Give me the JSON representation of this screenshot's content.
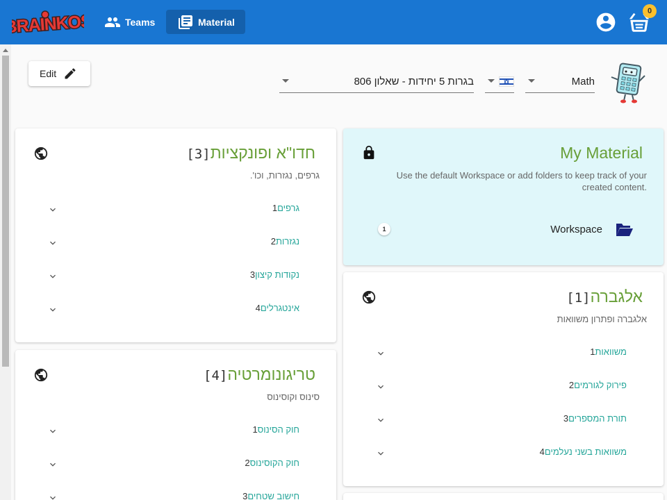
{
  "header": {
    "logo_text": "BRAINKOS",
    "nav": [
      {
        "label": "Teams",
        "icon": "people-icon"
      },
      {
        "label": "Material",
        "icon": "library-books-icon",
        "active": true
      }
    ],
    "cart_count": "0"
  },
  "toolbar": {
    "edit_label": "Edit",
    "curriculum": "בגרות 5 יחידות - שאלון 806",
    "language": "Hebrew",
    "subject": "Math"
  },
  "my_material": {
    "title": "My Material",
    "description": "Use the default Workspace or add folders to keep track of your created content.",
    "workspace_label": "Workspace",
    "workspace_count": "1"
  },
  "cards": {
    "algebra": {
      "num": "[1]",
      "title": "אלגברה",
      "subtitle": "אלגברה ופתרון משוואות",
      "items": [
        {
          "idx": "1",
          "label": "משוואות"
        },
        {
          "idx": "2",
          "label": "פירוק לגורמים"
        },
        {
          "idx": "3",
          "label": "תורת המספרים"
        },
        {
          "idx": "4",
          "label": "משוואות בשני נעלמים"
        }
      ]
    },
    "calculus": {
      "num": "[3]",
      "title": "חדו\"א ופונקציות",
      "subtitle": "גרפים, נגזרות, וכו'.",
      "items": [
        {
          "idx": "1",
          "label": "גרפים"
        },
        {
          "idx": "2",
          "label": "נגזרות"
        },
        {
          "idx": "3",
          "label": "נקודות קיצון"
        },
        {
          "idx": "4",
          "label": "אינטגרלים"
        }
      ]
    },
    "trig": {
      "num": "[4]",
      "title": "טריגונומרטיה",
      "subtitle": "סינוס וקוסינוס",
      "items": [
        {
          "idx": "1",
          "label": "חוק הסינוס"
        },
        {
          "idx": "2",
          "label": "חוק הקוסינוס"
        },
        {
          "idx": "3",
          "label": "חישוב שטחים"
        }
      ]
    }
  },
  "colors": {
    "header_bg": "#1976d2",
    "title_green": "#689f38",
    "link_teal": "#26a69a",
    "my_material_bg": "#e0f7fa",
    "badge_yellow": "#fbc02d"
  }
}
